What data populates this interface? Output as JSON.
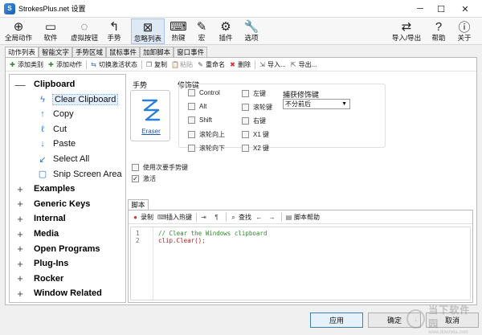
{
  "window": {
    "title": "StrokesPlus.net 设置"
  },
  "toolbar": {
    "left": [
      {
        "label": "全局动作",
        "icon": "globe-icon",
        "glyph": "⊕"
      },
      {
        "label": "软件",
        "icon": "app-window-icon",
        "glyph": "▭"
      },
      {
        "label": "虚拟按钮",
        "icon": "dotted-circle-icon",
        "glyph": "◌"
      },
      {
        "label": "手势",
        "icon": "gesture-arrow-icon",
        "glyph": "↰"
      },
      {
        "label": "忽略列表",
        "icon": "ignore-list-icon",
        "glyph": "⊠"
      },
      {
        "label": "热键",
        "icon": "keyboard-key-icon",
        "glyph": "⌨"
      },
      {
        "label": "宏",
        "icon": "pencil-macro-icon",
        "glyph": "✎"
      },
      {
        "label": "插件",
        "icon": "gear-plugin-icon",
        "glyph": "⚙"
      },
      {
        "label": "选项",
        "icon": "wrench-icon",
        "glyph": "🔧"
      }
    ],
    "right": [
      {
        "label": "导入/导出",
        "icon": "import-export-icon",
        "glyph": "⇄"
      },
      {
        "label": "帮助",
        "icon": "help-book-icon",
        "glyph": "?"
      },
      {
        "label": "关于",
        "icon": "about-icon",
        "glyph": "ⓘ"
      }
    ]
  },
  "tabs": [
    "动作列表",
    "智能文字",
    "手势区域",
    "鼠标事件",
    "加卸脚本",
    "窗口事件"
  ],
  "actionbar": [
    {
      "label": "添加类别",
      "icon": "add-category-icon",
      "glyph": "✚",
      "color": "#2e8b3a",
      "enabled": true
    },
    {
      "label": "添加动作",
      "icon": "add-action-icon",
      "glyph": "✚",
      "color": "#2e8b3a",
      "enabled": true
    },
    {
      "label": "切换激活状态",
      "icon": "toggle-active-icon",
      "glyph": "⇆",
      "color": "#3a67b0",
      "enabled": true
    },
    {
      "label": "复制",
      "icon": "copy-icon",
      "glyph": "❐",
      "color": "#555",
      "enabled": true
    },
    {
      "label": "粘贴",
      "icon": "paste-icon",
      "glyph": "📋",
      "color": "#999",
      "enabled": false
    },
    {
      "label": "重命名",
      "icon": "rename-icon",
      "glyph": "✎",
      "color": "#555",
      "enabled": true
    },
    {
      "label": "删除",
      "icon": "delete-icon",
      "glyph": "✖",
      "color": "#d62c2c",
      "enabled": true
    },
    {
      "label": "导入...",
      "icon": "import-icon",
      "glyph": "⇲",
      "color": "#555",
      "enabled": true
    },
    {
      "label": "导出...",
      "icon": "export-icon",
      "glyph": "⇱",
      "color": "#555",
      "enabled": true
    }
  ],
  "tree": {
    "categories": [
      {
        "name": "Clipboard",
        "expanded": true,
        "expander": "—"
      },
      {
        "name": "Examples",
        "expanded": false,
        "expander": "+"
      },
      {
        "name": "Generic Keys",
        "expanded": false,
        "expander": "+"
      },
      {
        "name": "Internal",
        "expanded": false,
        "expander": "+"
      },
      {
        "name": "Media",
        "expanded": false,
        "expander": "+"
      },
      {
        "name": "Open Programs",
        "expanded": false,
        "expander": "+"
      },
      {
        "name": "Plug-Ins",
        "expanded": false,
        "expander": "+"
      },
      {
        "name": "Rocker",
        "expanded": false,
        "expander": "+"
      },
      {
        "name": "Window Related",
        "expanded": false,
        "expander": "+"
      }
    ],
    "clipboard_actions": [
      {
        "name": "Clear Clipboard",
        "icon": "clear-gesture-icon",
        "glyph": "ϟ",
        "selected": true
      },
      {
        "name": "Copy",
        "icon": "copy-gesture-icon",
        "glyph": "↑",
        "selected": false
      },
      {
        "name": "Cut",
        "icon": "cut-gesture-icon",
        "glyph": "ℓ",
        "selected": false
      },
      {
        "name": "Paste",
        "icon": "paste-gesture-icon",
        "glyph": "↓",
        "selected": false
      },
      {
        "name": "Select All",
        "icon": "select-all-gesture-icon",
        "glyph": "↙",
        "selected": false
      },
      {
        "name": "Snip Screen Area",
        "icon": "snip-gesture-icon",
        "glyph": "▢",
        "selected": false
      }
    ]
  },
  "gesture": {
    "section_label": "手势",
    "name": "Eraser"
  },
  "modifiers": {
    "section_label": "修饰键",
    "col1": [
      {
        "label": "Control",
        "checked": false
      },
      {
        "label": "Alt",
        "checked": false
      },
      {
        "label": "Shift",
        "checked": false
      },
      {
        "label": "滚轮向上",
        "checked": false
      },
      {
        "label": "滚轮向下",
        "checked": false
      }
    ],
    "col2": [
      {
        "label": "左键",
        "checked": false
      },
      {
        "label": "滚轮键",
        "checked": false
      },
      {
        "label": "右键",
        "checked": false
      },
      {
        "label": "X1 键",
        "checked": false
      },
      {
        "label": "X2 键",
        "checked": false
      }
    ],
    "capture_label": "捕获修饰键",
    "capture_value": "不分前后"
  },
  "options": [
    {
      "label": "使用次要手势键",
      "checked": false
    },
    {
      "label": "激活",
      "checked": true
    }
  ],
  "script": {
    "tab_label": "脚本",
    "toolbar": [
      {
        "label": "录制",
        "icon": "record-icon",
        "glyph": "●",
        "color": "#d62c2c"
      },
      {
        "label": "插入热键",
        "icon": "insert-hotkey-icon",
        "glyph": "⌨",
        "color": "#555"
      },
      {
        "label": "",
        "icon": "indent-icon",
        "glyph": "⇥",
        "color": "#555"
      },
      {
        "label": "",
        "icon": "format-icon",
        "glyph": "¶",
        "color": "#555"
      },
      {
        "label": "查找",
        "icon": "find-icon",
        "glyph": "⌕",
        "color": "#222"
      },
      {
        "label": "",
        "icon": "back-icon",
        "glyph": "←",
        "color": "#222"
      },
      {
        "label": "",
        "icon": "forward-icon",
        "glyph": "→",
        "color": "#222"
      },
      {
        "label": "脚本帮助",
        "icon": "script-help-icon",
        "glyph": "▤",
        "color": "#555"
      }
    ],
    "lines": [
      {
        "num": "1",
        "text": "// Clear the Windows clipboard",
        "kind": "comment"
      },
      {
        "num": "2",
        "text": "clip.Clear();",
        "kind": "code"
      }
    ]
  },
  "buttons": {
    "apply": "应用",
    "ok": "确定",
    "cancel": "取消"
  },
  "watermark": {
    "cn": "当下软件园",
    "en": "www.downxia.com"
  }
}
